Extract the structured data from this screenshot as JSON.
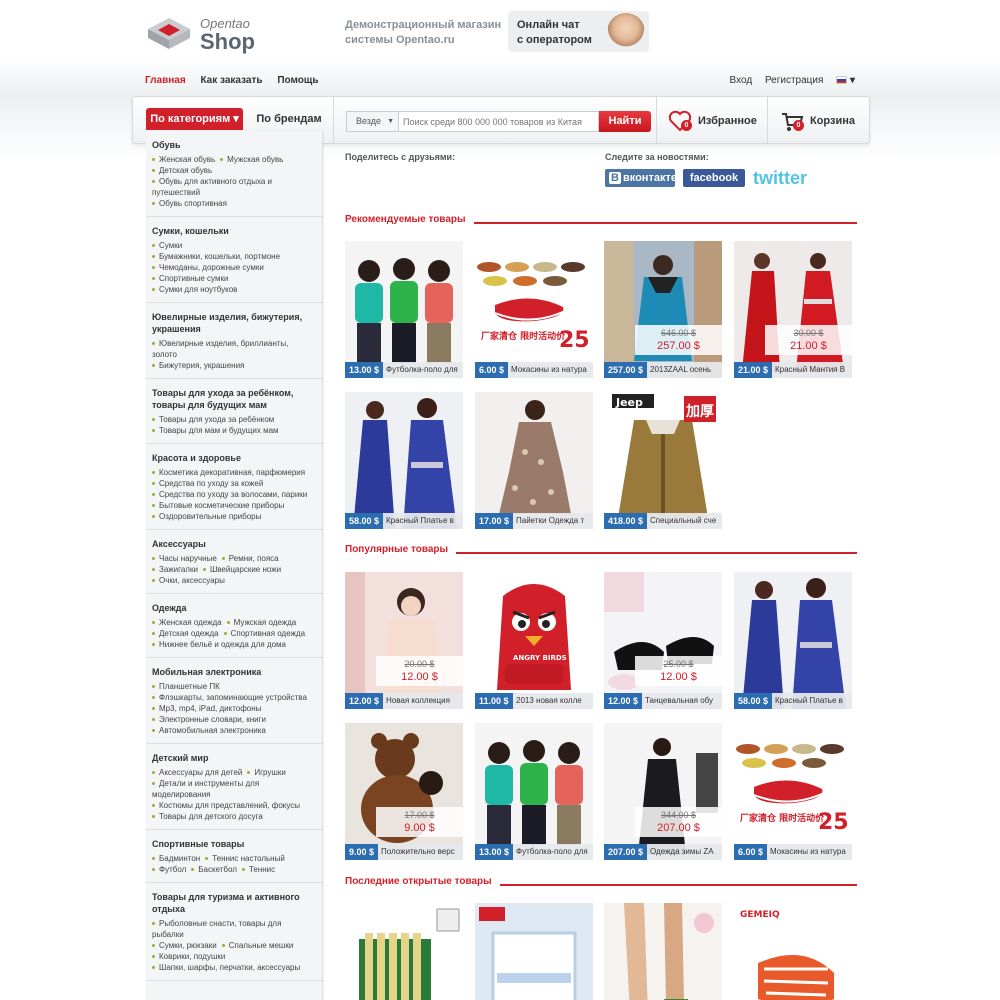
{
  "header": {
    "logo_top": "Opentao",
    "logo_main": "Shop",
    "demo_line1": "Демонстрационный магазин",
    "demo_line2": "системы Opentao.ru",
    "chat_line1": "Онлайн чат",
    "chat_line2": "с оператором"
  },
  "nav": {
    "main": "Главная",
    "how": "Как заказать",
    "help": "Помощь",
    "login": "Вход",
    "register": "Регистрация",
    "lang_arrow": "▾"
  },
  "search": {
    "tab_categories": "По категориям ▾",
    "tab_brands": "По брендам",
    "scope": "Везде",
    "scope_arrow": "▼",
    "placeholder": "Поиск среди 800 000 000 товаров из Китая",
    "button": "Найти",
    "favorites": "Избранное",
    "favorites_count": "0",
    "cart": "Корзина",
    "cart_count": "0"
  },
  "categories": [
    {
      "title": "Обувь",
      "items": [
        "Женская обувь",
        "Мужская обувь",
        "Детская обувь",
        "Обувь для активного отдыха и путешествий",
        "Обувь спортивная"
      ]
    },
    {
      "title": "Сумки, кошельки",
      "items": [
        "Сумки",
        "Бумажники, кошельки, портмоне",
        "Чемоданы, дорожные сумки",
        "Спортивные сумки",
        "Сумки для ноутбуков"
      ]
    },
    {
      "title": "Ювелирные изделия, бижутерия, украшения",
      "items": [
        "Ювелирные изделия, бриллианты, золото",
        "Бижутерия, украшения"
      ]
    },
    {
      "title": "Товары для ухода за ребёнком, товары для будущих мам",
      "items": [
        "Товары для ухода за ребёнком",
        "Товары для мам и будущих мам"
      ]
    },
    {
      "title": "Красота и здоровье",
      "items": [
        "Косметика декоративная, парфюмерия",
        "Средства по уходу за кожей",
        "Средства по уходу за волосами, парики",
        "Бытовые косметические приборы",
        "Оздоровительные приборы"
      ]
    },
    {
      "title": "Аксессуары",
      "items": [
        "Часы наручные",
        "Ремни, пояса",
        "Зажигалки",
        "Швейцарские ножи",
        "Очки, аксессуары"
      ]
    },
    {
      "title": "Одежда",
      "items": [
        "Женская одежда",
        "Мужская одежда",
        "Детская одежда",
        "Спортивная одежда",
        "Нижнее бельё и одежда для дома"
      ]
    },
    {
      "title": "Мобильная электроника",
      "items": [
        "Планшетные ПК",
        "Флэшкарты, запоминающие устройства",
        "Mp3, mp4, iPad, диктофоны",
        "Электронные словари, книги",
        "Автомобильная электроника"
      ]
    },
    {
      "title": "Детский мир",
      "items": [
        "Аксессуары для детей",
        "Игрушки",
        "Детали и инструменты для моделирования",
        "Костюмы для представлений, фокусы",
        "Товары для детского досуга"
      ]
    },
    {
      "title": "Спортивные товары",
      "items": [
        "Бадминтон",
        "Теннис настольный",
        "Футбол",
        "Баскетбол",
        "Теннис"
      ]
    },
    {
      "title": "Товары для туризма и активного отдыха",
      "items": [
        "Рыболовные снасти, товары для рыбалки",
        "Сумки, рюкзаки",
        "Спальные мешки",
        "Коврики, подушки",
        "Шапки, шарфы, перчатки, аксессуары"
      ]
    }
  ],
  "social": {
    "share": "Поделитесь с друзьями:",
    "follow": "Следите за новостями:",
    "vk": "вконтакте",
    "vk_logo": "В",
    "facebook": "facebook",
    "twitter": "twitter"
  },
  "sections": {
    "recommended": "Рекомендуемые товары",
    "popular": "Популярные товары",
    "recent": "Последние открытые товары"
  },
  "recommended": [
    {
      "price": "13.00 $",
      "name": "Футболка-поло для",
      "old": "",
      "new": ""
    },
    {
      "price": "6.00 $",
      "name": "Мокасины из натура",
      "old": "",
      "new": ""
    },
    {
      "price": "257.00 $",
      "name": "2013ZAAL осень",
      "old": "646.00 $",
      "new": "257.00 $"
    },
    {
      "price": "21.00 $",
      "name": "Красный Мантия В",
      "old": "30.00 $",
      "new": "21.00 $"
    },
    {
      "price": "58.00 $",
      "name": "Красный Платье в",
      "old": "",
      "new": ""
    },
    {
      "price": "17.00 $",
      "name": "Пайетки Одежда т",
      "old": "",
      "new": ""
    },
    {
      "price": "418.00 $",
      "name": "Специальный сче",
      "old": "",
      "new": ""
    }
  ],
  "popular": [
    {
      "price": "12.00 $",
      "name": "Новая коллекция",
      "old": "20.00 $",
      "new": "12.00 $"
    },
    {
      "price": "11.00 $",
      "name": "2013 новая колле",
      "old": "",
      "new": ""
    },
    {
      "price": "12.00 $",
      "name": "Танцевальная обу",
      "old": "25.00 $",
      "new": "12.00 $"
    },
    {
      "price": "58.00 $",
      "name": "Красный Платье в",
      "old": "",
      "new": ""
    },
    {
      "price": "9.00 $",
      "name": "Положительно верс",
      "old": "17.00 $",
      "new": "9.00 $"
    },
    {
      "price": "13.00 $",
      "name": "Футболка-поло для",
      "old": "",
      "new": ""
    },
    {
      "price": "207.00 $",
      "name": "Одежда зимы ZA",
      "old": "344.00 $",
      "new": "207.00 $"
    },
    {
      "price": "6.00 $",
      "name": "Мокасины из натура",
      "old": "",
      "new": ""
    }
  ],
  "image_text": {
    "shoes_banner": "厂家清仓 限时活动价",
    "shoes_num": "25",
    "jeep": "Jeep",
    "thick": "加厚",
    "angry": "ANGRY BIRDS",
    "gemeiq": "GEMEIQ"
  },
  "colors": {
    "accent": "#d1202a",
    "price_blue": "#2b6db0",
    "bullet": "#8cb33b"
  }
}
